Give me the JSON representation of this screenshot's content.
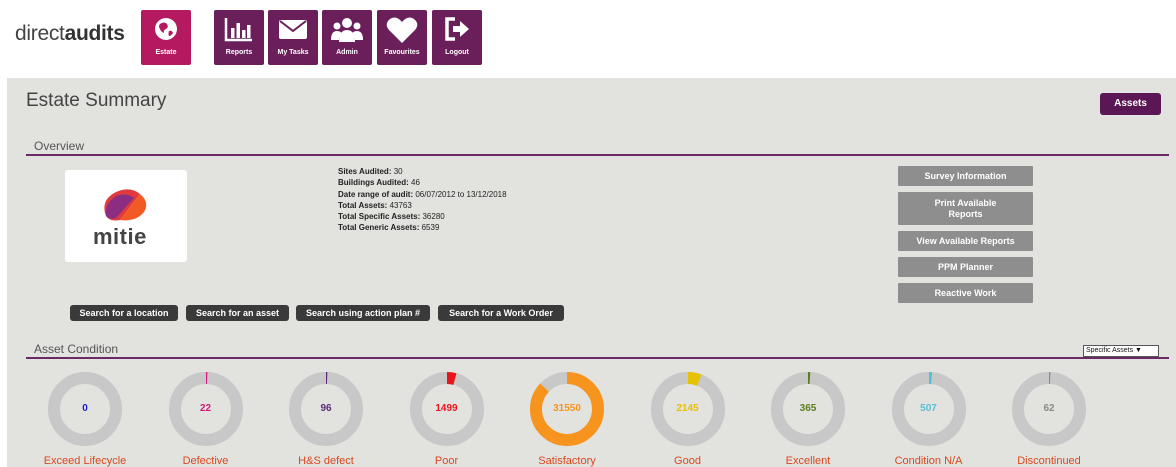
{
  "brand": {
    "prefix": "direct",
    "bold": "audits"
  },
  "nav": [
    {
      "label": "Estate",
      "icon": "globe-icon",
      "active": true
    },
    {
      "label": "Reports",
      "icon": "bar-chart-icon",
      "active": false
    },
    {
      "label": "My Tasks",
      "icon": "envelope-icon",
      "active": false
    },
    {
      "label": "Admin",
      "icon": "users-icon",
      "active": false
    },
    {
      "label": "Favourites",
      "icon": "heart-icon",
      "active": false
    },
    {
      "label": "Logout",
      "icon": "logout-icon",
      "active": false
    }
  ],
  "page": {
    "title": "Estate Summary",
    "assets_button": "Assets"
  },
  "overview": {
    "heading": "Overview",
    "logo_text": "mitie",
    "stats": [
      {
        "label": "Sites Audited:",
        "value": "30"
      },
      {
        "label": "Buildings Audited:",
        "value": "46"
      },
      {
        "label": "Date range of audit:",
        "value": "06/07/2012 to 13/12/2018"
      },
      {
        "label": "Total Assets:",
        "value": "43763"
      },
      {
        "label": "Total Specific Assets:",
        "value": "36280"
      },
      {
        "label": "Total Generic Assets:",
        "value": "6539"
      }
    ],
    "side_buttons": [
      "Survey Information",
      "Print Available Reports",
      "View Available Reports",
      "PPM Planner",
      "Reactive Work"
    ],
    "search_buttons": [
      "Search for a location",
      "Search for an asset",
      "Search using action plan #",
      "Search for a Work Order"
    ]
  },
  "condition": {
    "heading": "Asset Condition",
    "filter_selected": "Specific Assets",
    "total": 36280,
    "items": [
      {
        "label": "Exceed Lifecycle",
        "value": 0,
        "color": "#1e1ecc"
      },
      {
        "label": "Defective",
        "value": 22,
        "color": "#d2197a"
      },
      {
        "label": "H&S defect",
        "value": 96,
        "color": "#5a2a7a"
      },
      {
        "label": "Poor",
        "value": 1499,
        "color": "#e8161c"
      },
      {
        "label": "Satisfactory",
        "value": 31550,
        "color": "#f7941d"
      },
      {
        "label": "Good",
        "value": 2145,
        "color": "#e6c200"
      },
      {
        "label": "Excellent",
        "value": 365,
        "color": "#5a7d1f"
      },
      {
        "label": "Condition N/A",
        "value": 507,
        "color": "#55c0d8"
      },
      {
        "label": "Discontinued",
        "value": 62,
        "color": "#8a8a8a"
      }
    ]
  },
  "colors": {
    "accent": "#6b1f5a",
    "active_nav": "#b5195f",
    "panel_bg": "#e2e2df",
    "ring_track": "#c8c8c8"
  }
}
